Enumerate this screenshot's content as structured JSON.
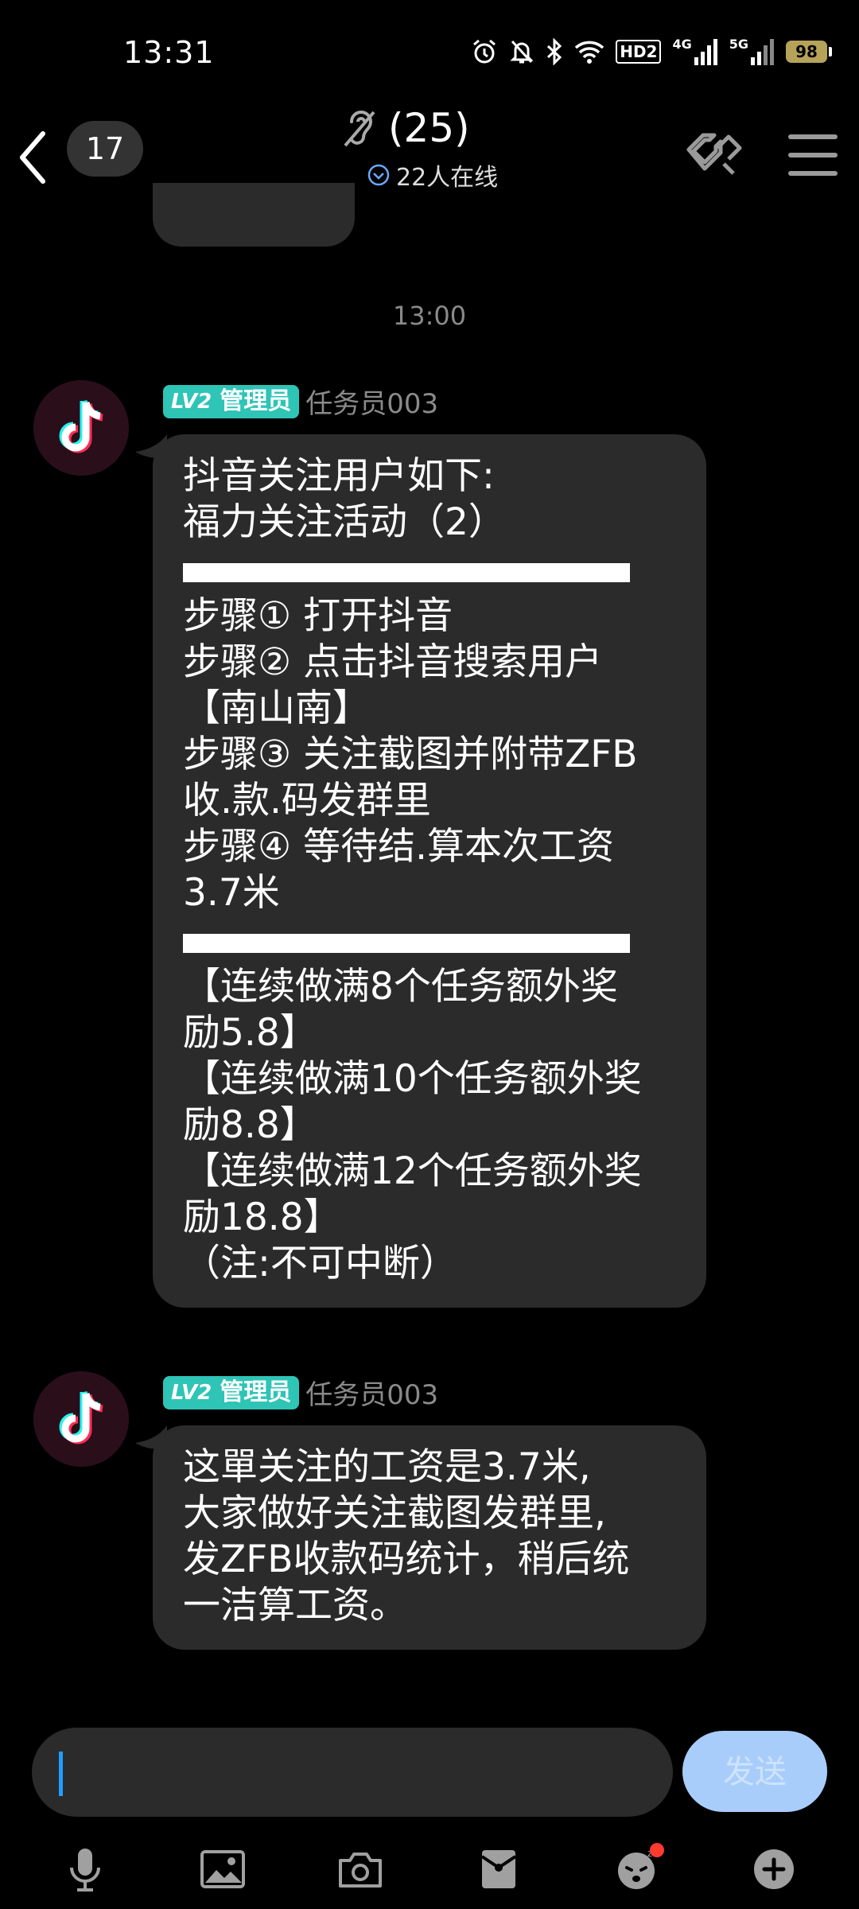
{
  "status_bar": {
    "time": "13:31",
    "hd_label": "HD2",
    "net1": "4G",
    "net2": "5G",
    "battery": "98",
    "icons": [
      "alarm-icon",
      "mute-icon",
      "bluetooth-icon",
      "wifi-icon",
      "signal-icon",
      "battery-icon"
    ]
  },
  "nav": {
    "unread_count": "17",
    "title": "(25)",
    "online_text": "22人在线",
    "icons": [
      "back-icon",
      "ear-icon",
      "link-icon",
      "menu-icon"
    ]
  },
  "time_divider": "13:00",
  "messages": [
    {
      "level": "LV2",
      "role": "管理员",
      "sender": "任务员003",
      "lines": [
        "抖音关注用户如下:",
        "福力关注活动（2）",
        "步骤① 打开抖音",
        "步骤② 点击抖音搜索用户",
        "【南山南】",
        "步骤③ 关注截图并附带ZFB",
        "收.款.码发群里",
        "步骤④ 等待结.算本次工资",
        "3.7米",
        "【连续做满8个任务额外奖",
        "励5.8】",
        "【连续做满10个任务额外奖",
        "励8.8】",
        "【连续做满12个任务额外奖",
        "励18.8】",
        "（注:不可中断）"
      ]
    },
    {
      "level": "LV2",
      "role": "管理员",
      "sender": "任务员003",
      "lines": [
        "这單关注的工资是3.7米,",
        "大家做好关注截图发群里,",
        "发ZFB收款码统计，稍后统",
        "一洁算工资。"
      ]
    }
  ],
  "input": {
    "placeholder": "",
    "send_label": "发送"
  },
  "toolbar_icons": [
    "microphone-icon",
    "image-icon",
    "camera-icon",
    "red-packet-icon",
    "emoji-icon",
    "plus-icon"
  ],
  "colors": {
    "background": "#000000",
    "bubble": "#2b2b2b",
    "role_badge": "#2ec4b6",
    "send_button": "#a9cdfa",
    "caret": "#1e9fff"
  }
}
